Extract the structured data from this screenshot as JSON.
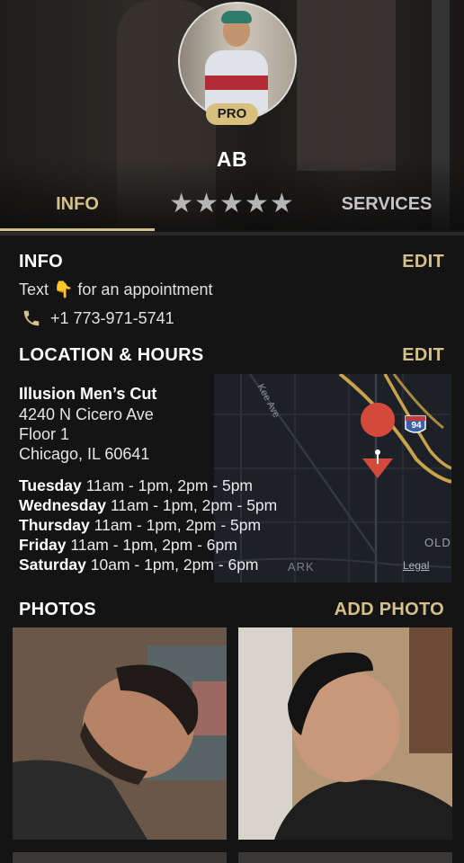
{
  "profile": {
    "badge": "PRO",
    "name": "AB"
  },
  "tabs": {
    "info": "INFO",
    "stars": "★★★★★",
    "services": "SERVICES"
  },
  "info": {
    "title": "INFO",
    "edit": "EDIT",
    "text": "Text 👇 for an appointment",
    "phone": "+1 773-971-5741"
  },
  "location": {
    "title": "LOCATION & HOURS",
    "edit": "EDIT",
    "business": "Illusion Men’s Cut",
    "street": "4240 N Cicero Ave",
    "floor": "Floor 1",
    "city": "Chicago, IL 60641",
    "hours": [
      {
        "day": "Tuesday",
        "time": "11am - 1pm, 2pm - 5pm"
      },
      {
        "day": "Wednesday",
        "time": "11am - 1pm, 2pm - 5pm"
      },
      {
        "day": "Thursday",
        "time": "11am - 1pm, 2pm - 5pm"
      },
      {
        "day": "Friday",
        "time": "11am - 1pm, 2pm - 6pm"
      },
      {
        "day": "Saturday",
        "time": "10am - 1pm, 2pm - 6pm"
      }
    ]
  },
  "map": {
    "street_label": "Kee Ave",
    "highway": "94",
    "area_label": "OLD",
    "area_label2": "ARK",
    "legal": "Legal",
    "road_color": "#c9a24a",
    "pin_color": "#d44a3a"
  },
  "photos": {
    "title": "PHOTOS",
    "add": "ADD PHOTO"
  },
  "colors": {
    "accent": "#d6c08a",
    "background": "#141414"
  }
}
